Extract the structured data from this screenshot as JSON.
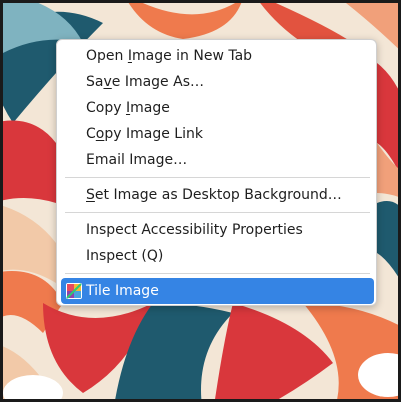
{
  "context_menu": {
    "items": [
      {
        "pre": "Open ",
        "acc": "I",
        "post": "mage in New Tab"
      },
      {
        "pre": "Sa",
        "acc": "v",
        "post": "e Image As…"
      },
      {
        "pre": "Copy ",
        "acc": "I",
        "post": "mage"
      },
      {
        "pre": "C",
        "acc": "o",
        "post": "py Image Link"
      },
      {
        "pre": "Email Image…",
        "acc": "",
        "post": ""
      },
      {
        "pre": "",
        "acc": "S",
        "post": "et Image as Desktop Background…"
      },
      {
        "pre": "Inspect Accessibility Properties",
        "acc": "",
        "post": ""
      },
      {
        "pre": "Inspect (Q)",
        "acc": "",
        "post": ""
      },
      {
        "pre": "Tile Image",
        "acc": "",
        "post": ""
      }
    ],
    "active_icon": "tile-image-icon",
    "highlight_color": "#3584e4"
  }
}
